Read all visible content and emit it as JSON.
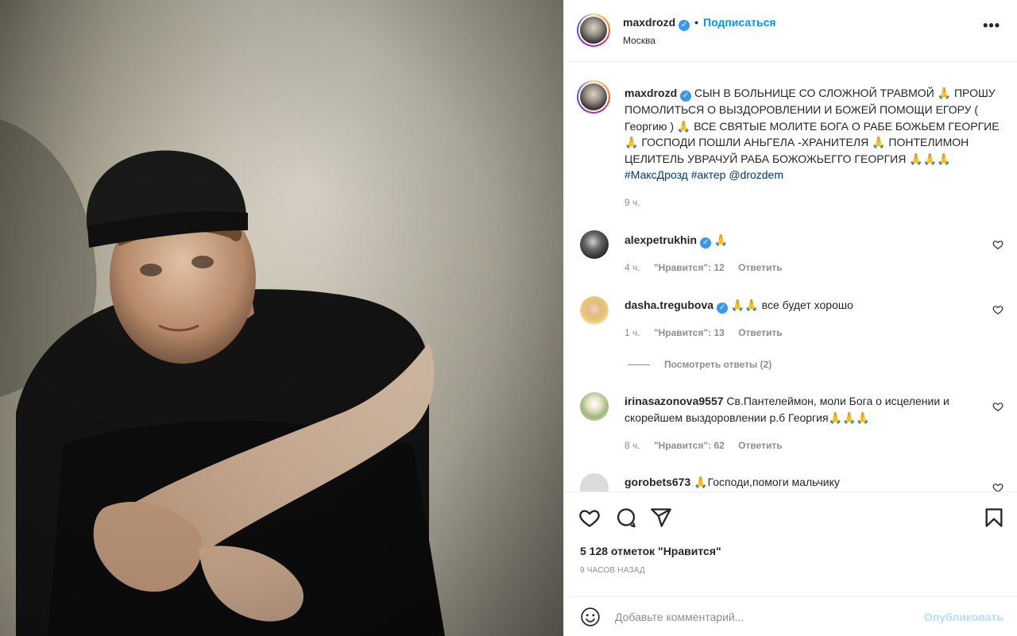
{
  "post": {
    "author": "maxdrozd",
    "follow_label": "Подписаться",
    "dot": "•",
    "location": "Москва",
    "more_label": "•••"
  },
  "caption": {
    "username": "maxdrozd",
    "text": "СЫН В БОЛЬНИЦЕ СО СЛОЖНОЙ ТРАВМОЙ 🙏 ПРОШУ ПОМОЛИТЬСЯ О ВЫЗДОРОВЛЕНИИ И БОЖЕЙ ПОМОЩИ ЕГОРУ ( Георгию ) 🙏 ВСЕ СВЯТЫЕ МОЛИТЕ БОГА О РАБЕ БОЖЬЕМ ГЕОРГИЕ 🙏 ГОСПОДИ ПОШЛИ АНЬГЕЛА -ХРАНИТЕЛЯ 🙏 ПОНТЕЛИМОН ЦЕЛИТЕЛЬ УВРАЧУЙ РАБА БОЖОЖЬЕГГО ГЕОРГИЯ 🙏🙏🙏",
    "tags": [
      "#МаксДрозд",
      "#актер",
      "@drozdem"
    ],
    "time": "9 ч."
  },
  "comments": [
    {
      "username": "alexpetrukhin",
      "verified": true,
      "text": "🙏",
      "time": "4 ч.",
      "likes": "\"Нравится\": 12",
      "reply": "Ответить"
    },
    {
      "username": "dasha.tregubova",
      "verified": true,
      "text": "🙏🙏 все будет хорошо",
      "time": "1 ч.",
      "likes": "\"Нравится\": 13",
      "reply": "Ответить"
    },
    {
      "username": "irinasazonova9557",
      "verified": false,
      "text": "Св.Пантелеймон, моли Бога о исцелении и скорейшем выздоровлении р.б Георгия🙏🙏🙏",
      "time": "8 ч.",
      "likes": "\"Нравится\": 62",
      "reply": "Ответить"
    },
    {
      "username": "gorobets673",
      "verified": false,
      "text": "🙏Господи,помоги мальчику"
    }
  ],
  "view_replies": "Посмотреть ответы (2)",
  "likes_total": "5 128 отметок \"Нравится\"",
  "posted_ago": "9 ЧАСОВ НАЗАД",
  "comment_box": {
    "placeholder": "Добавьте комментарий...",
    "publish_label": "Опубликовать"
  },
  "colors": {
    "accent": "#0095f6",
    "verified": "#3897f0",
    "hashtag": "#00376b",
    "muted": "#8e8e8e",
    "publish_disabled": "#b2dffc"
  },
  "icons": [
    "verified-icon",
    "more-icon",
    "heart-icon",
    "comment-icon",
    "share-icon",
    "bookmark-icon",
    "emoji-icon"
  ]
}
